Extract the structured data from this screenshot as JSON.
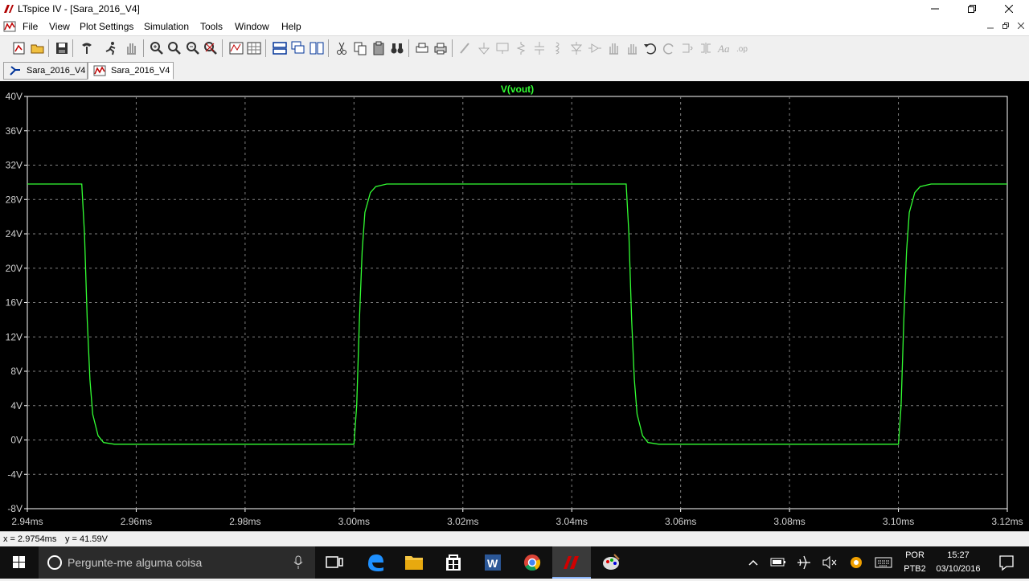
{
  "window": {
    "title": "LTspice IV - [Sara_2016_V4]"
  },
  "menu": {
    "items": [
      {
        "label": "File"
      },
      {
        "label": "View"
      },
      {
        "label": "Plot Settings"
      },
      {
        "label": "Simulation"
      },
      {
        "label": "Tools"
      },
      {
        "label": "Window"
      },
      {
        "label": "Help"
      }
    ]
  },
  "tabs": [
    {
      "label": "Sara_2016_V4",
      "icon": "schematic-icon"
    },
    {
      "label": "Sara_2016_V4",
      "icon": "waveform-icon"
    }
  ],
  "plot": {
    "trace_label": "V(vout)",
    "trace_color": "#33ff33",
    "grid_color": "#808080",
    "background": "#000000"
  },
  "chart_data": {
    "type": "line",
    "title": "V(vout)",
    "xlabel": "",
    "ylabel": "",
    "xlim": [
      2.94,
      3.12
    ],
    "ylim": [
      -8,
      40
    ],
    "x_ticks": [
      "2.94ms",
      "2.96ms",
      "2.98ms",
      "3.00ms",
      "3.02ms",
      "3.04ms",
      "3.06ms",
      "3.08ms",
      "3.10ms",
      "3.12ms"
    ],
    "y_ticks": [
      "40V",
      "36V",
      "32V",
      "28V",
      "24V",
      "20V",
      "16V",
      "12V",
      "8V",
      "4V",
      "0V",
      "-4V",
      "-8V"
    ],
    "x_tick_values": [
      2.94,
      2.96,
      2.98,
      3.0,
      3.02,
      3.04,
      3.06,
      3.08,
      3.1,
      3.12
    ],
    "y_tick_values": [
      40,
      36,
      32,
      28,
      24,
      20,
      16,
      12,
      8,
      4,
      0,
      -4,
      -8
    ],
    "grid": true,
    "series": [
      {
        "name": "V(vout)",
        "x": [
          2.94,
          2.95,
          2.9505,
          2.951,
          2.9515,
          2.952,
          2.953,
          2.954,
          2.956,
          3.0,
          3.0005,
          3.001,
          3.0015,
          3.002,
          3.003,
          3.004,
          3.006,
          3.05,
          3.0505,
          3.051,
          3.0515,
          3.052,
          3.053,
          3.054,
          3.056,
          3.1,
          3.1005,
          3.101,
          3.1015,
          3.102,
          3.103,
          3.104,
          3.106,
          3.12
        ],
        "y": [
          29.8,
          29.8,
          24,
          14,
          7,
          3,
          0.5,
          -0.3,
          -0.5,
          -0.5,
          4,
          14,
          22,
          26.5,
          28.8,
          29.5,
          29.8,
          29.8,
          24,
          14,
          7,
          3,
          0.5,
          -0.3,
          -0.5,
          -0.5,
          4,
          14,
          22,
          26.5,
          28.8,
          29.5,
          29.8,
          29.8
        ]
      }
    ]
  },
  "status": {
    "x_readout": "x = 2.9754ms",
    "y_readout": "y = 41.59V"
  },
  "taskbar": {
    "search_placeholder": "Pergunte-me alguma coisa",
    "lang_top": "POR",
    "lang_bottom": "PTB2",
    "time": "15:27",
    "date": "03/10/2016"
  }
}
